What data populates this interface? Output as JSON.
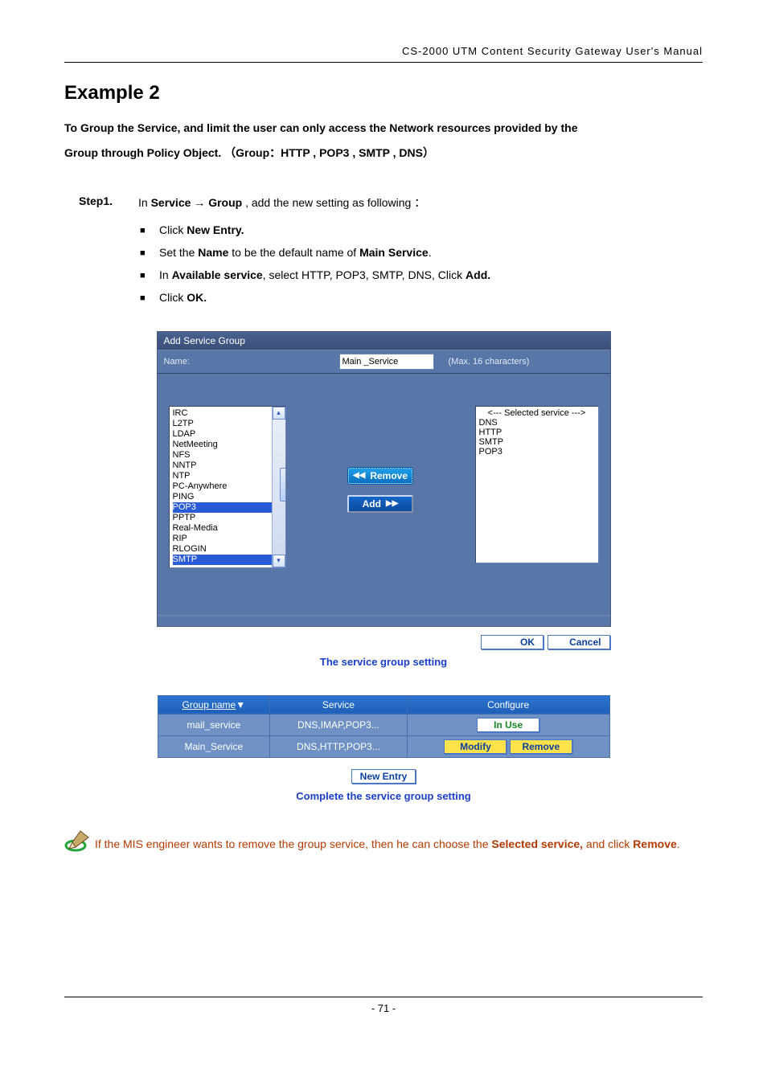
{
  "header": "CS-2000 UTM Content Security Gateway User's Manual",
  "title": "Example 2",
  "intro_line1": "To Group the Service, and limit the user can only access the Network resources provided by the",
  "intro_line2_pre": "Group through Policy Object.",
  "intro_line2_paren": "（Group：HTTP , POP3 , SMTP , DNS）",
  "step": {
    "label": "Step1.",
    "pre": "In ",
    "b1": "Service ",
    "arrow": " → ",
    "b2": "Group",
    "post": " , add the new setting as following ："
  },
  "bullets": [
    {
      "pre": "Click ",
      "b": "New Entry."
    },
    {
      "pre": "Set the ",
      "b": "Name",
      "mid": " to be the default name of ",
      "b2": "Main Service",
      "post": "."
    },
    {
      "pre": "In ",
      "b": "Available service",
      "mid": ", select HTTP, POP3, SMTP, DNS, Click ",
      "b2": "Add."
    },
    {
      "pre": "Click ",
      "b": "OK."
    }
  ],
  "dialog": {
    "title": "Add Service Group",
    "name_label": "Name:",
    "name_value": "Main _Service",
    "name_hint": "(Max. 16 characters)",
    "available": [
      "IRC",
      "L2TP",
      "LDAP",
      "NetMeeting",
      "NFS",
      "NNTP",
      "NTP",
      "PC-Anywhere",
      "PING",
      "POP3",
      "PPTP",
      "Real-Media",
      "RIP",
      "RLOGIN",
      "SMTP"
    ],
    "available_selected": [
      "POP3",
      "SMTP"
    ],
    "remove_label": "Remove",
    "add_label": "Add",
    "selected_header": "<--- Selected service --->",
    "selected": [
      "DNS",
      "HTTP",
      "SMTP",
      "POP3"
    ]
  },
  "ok_label": "OK",
  "cancel_label": "Cancel",
  "caption1": "The service group setting",
  "table": {
    "headers": [
      "Group name",
      "Service",
      "Configure"
    ],
    "rows": [
      {
        "name": "mail_service",
        "service": "DNS,IMAP,POP3...",
        "cfg_type": "inuse",
        "inuse_label": "In  Use"
      },
      {
        "name": "Main_Service",
        "service": "DNS,HTTP,POP3...",
        "cfg_type": "modrem",
        "modify_label": "Modify",
        "remove_label": "Remove"
      }
    ]
  },
  "new_entry_label": "New Entry",
  "caption2": "Complete the service group setting",
  "note": {
    "pre": "If the MIS engineer wants to remove the group service, then he can choose the ",
    "b1": "Selected service,",
    "mid": " and click ",
    "b2": "Remove",
    "post": "."
  },
  "page_no": "- 71 -"
}
